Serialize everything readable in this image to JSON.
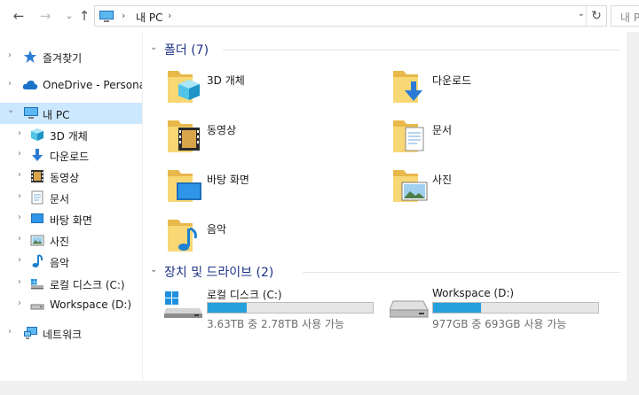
{
  "address": {
    "back_glyph": "←",
    "forward_glyph": "→",
    "up_glyph": "↑",
    "chevron": "›",
    "path": "내 PC",
    "caret": "⌄",
    "refresh_glyph": "↻",
    "search_placeholder": "내 PC 검색"
  },
  "nav": {
    "quick_access": "즐겨찾기",
    "onedrive": "OneDrive - Personal",
    "this_pc": "내 PC",
    "items": [
      {
        "label": "3D 개체",
        "icon": "3d-objects-icon"
      },
      {
        "label": "다운로드",
        "icon": "download-icon"
      },
      {
        "label": "동영상",
        "icon": "video-icon"
      },
      {
        "label": "문서",
        "icon": "document-icon"
      },
      {
        "label": "바탕 화면",
        "icon": "desktop-icon"
      },
      {
        "label": "사진",
        "icon": "picture-icon"
      },
      {
        "label": "음악",
        "icon": "music-icon"
      },
      {
        "label": "로컬 디스크 (C:)",
        "icon": "windows-drive-icon"
      },
      {
        "label": "Workspace (D:)",
        "icon": "drive-icon"
      }
    ],
    "network": "네트워크",
    "expand_glyph": "›",
    "expanded_glyph": "⌄"
  },
  "folders": {
    "title": "폴더 (7)",
    "items": [
      {
        "label": "3D 개체",
        "icon": "3d-objects-folder-icon"
      },
      {
        "label": "다운로드",
        "icon": "download-folder-icon"
      },
      {
        "label": "동영상",
        "icon": "video-folder-icon"
      },
      {
        "label": "문서",
        "icon": "document-folder-icon"
      },
      {
        "label": "바탕 화면",
        "icon": "desktop-folder-icon"
      },
      {
        "label": "사진",
        "icon": "picture-folder-icon"
      },
      {
        "label": "음악",
        "icon": "music-folder-icon"
      }
    ]
  },
  "drives": {
    "title": "장치 및 드라이브 (2)",
    "items": [
      {
        "name": "로컬 디스크 (C:)",
        "info": "3.63TB 중 2.78TB 사용 가능",
        "used_fraction": 0.235,
        "icon": "windows-drive-icon"
      },
      {
        "name": "Workspace (D:)",
        "info": "977GB 중 693GB 사용 가능",
        "used_fraction": 0.29,
        "icon": "drive-icon"
      }
    ]
  },
  "colors": {
    "accent": "#26a0da",
    "group_title": "#1e3287",
    "selection": "#cce8ff",
    "folder": "#f8d775"
  }
}
